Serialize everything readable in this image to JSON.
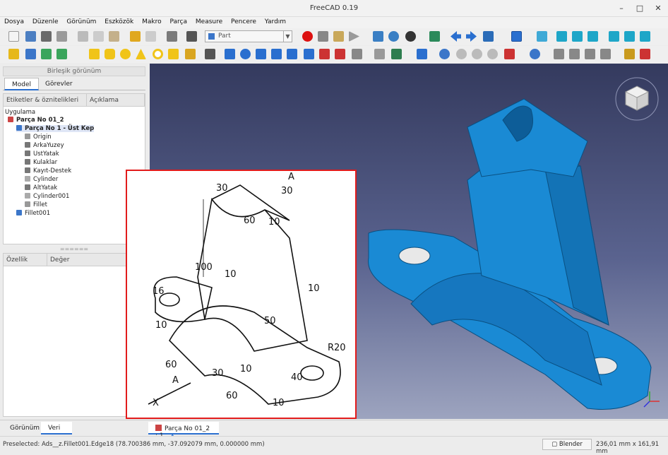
{
  "window": {
    "title": "FreeCAD 0.19"
  },
  "menu": [
    "Dosya",
    "Düzenle",
    "Görünüm",
    "Eszközök",
    "Makro",
    "Parça",
    "Measure",
    "Pencere",
    "Yardım"
  ],
  "toolbar": {
    "workbench": "Part"
  },
  "combo_view": {
    "title": "Birleşik görünüm",
    "tabs": [
      "Model",
      "Görevler"
    ],
    "columns": [
      "Etiketler & öznitelikleri",
      "Açıklama"
    ],
    "tree": {
      "root": "Uygulama",
      "items": [
        {
          "label": "Parça No 01_2",
          "level": 1
        },
        {
          "label": "Parça No 1 - Üst Kep",
          "level": 2
        },
        {
          "label": "Origin",
          "level": 3
        },
        {
          "label": "ArkaYuzey",
          "level": 3
        },
        {
          "label": "UstYatak",
          "level": 3
        },
        {
          "label": "Kulaklar",
          "level": 3
        },
        {
          "label": "Kayıt-Destek",
          "level": 3
        },
        {
          "label": "Cylinder",
          "level": 3
        },
        {
          "label": "AltYatak",
          "level": 3
        },
        {
          "label": "Cylinder001",
          "level": 3
        },
        {
          "label": "Fillet",
          "level": 3
        },
        {
          "label": "Fillet001",
          "level": 2
        }
      ]
    },
    "splitter": "======",
    "property_columns": [
      "Özellik",
      "Değer"
    ]
  },
  "bottom_tabs": [
    "Görünüm",
    "Veri"
  ],
  "document_tab": "Parça No 01_2 : 1",
  "drawing": {
    "dims": [
      "30",
      "30",
      "A",
      "60",
      "10",
      "100",
      "10",
      "50",
      "10",
      "16",
      "10",
      "R20",
      "40",
      "60",
      "30",
      "10",
      "60",
      "A",
      "X",
      "10"
    ]
  },
  "status": {
    "preselected": "Preselected: Ads__z.Fillet001.Edge18 (78.700386 mm, -37.092079 mm, 0.000000 mm)",
    "nav_style": "Blender",
    "dimensions": "236,01 mm x 161,91 mm"
  },
  "colors": {
    "part": "#1a8ad4",
    "accent": "#2a6fcf",
    "overlay_border": "#e21b1b"
  }
}
